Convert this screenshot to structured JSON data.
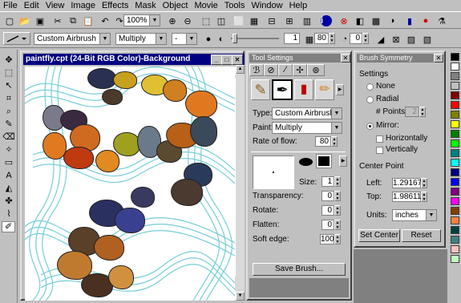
{
  "menu": [
    "File",
    "Edit",
    "View",
    "Image",
    "Effects",
    "Mask",
    "Object",
    "Movie",
    "Tools",
    "Window",
    "Help"
  ],
  "toolbar1": {
    "zoom": "100%"
  },
  "toolbar2": {
    "brush_type": "Custom Airbrush",
    "merge_mode": "Multiply",
    "dash_value": "-",
    "size_value": "1",
    "transparency_value": "80",
    "angle_value": "0"
  },
  "document": {
    "title": "paintfly.cpt  (24-Bit RGB Color)-Background"
  },
  "tool_settings": {
    "title": "Tool Settings",
    "type_label": "Type:",
    "type_value": "Custom Airbrush",
    "paint_label": "Paint:",
    "paint_value": "Multiply",
    "rate_label": "Rate of flow:",
    "rate_value": "80",
    "size_label": "Size:",
    "size_value": "1",
    "transparency_label": "Transparency:",
    "transparency_value": "0",
    "rotate_label": "Rotate:",
    "rotate_value": "0",
    "flatten_label": "Flatten:",
    "flatten_value": "0",
    "soft_edge_label": "Soft edge:",
    "soft_edge_value": "100",
    "save_brush": "Save Brush..."
  },
  "brush_symmetry": {
    "title": "Brush Symmetry",
    "settings_label": "Settings",
    "none_label": "None",
    "radial_label": "Radial",
    "points_label": "# Points:",
    "points_value": "2",
    "mirror_label": "Mirror:",
    "horizontally_label": "Horizontally",
    "vertically_label": "Vertically",
    "center_point_label": "Center Point",
    "left_label": "Left:",
    "left_value": "1.29167",
    "top_label": "Top:",
    "top_value": "1.98611",
    "units_label": "Units:",
    "units_value": "inches",
    "set_center": "Set Center",
    "reset": "Reset",
    "selected_mode": "Mirror"
  },
  "palette_colors": [
    "#000000",
    "#ffffff",
    "#808080",
    "#c0c0c0",
    "#800000",
    "#ff0000",
    "#808000",
    "#ffff00",
    "#008000",
    "#00ff00",
    "#008080",
    "#00ffff",
    "#000080",
    "#0000ff",
    "#800080",
    "#ff00ff",
    "#804000",
    "#ff8040",
    "#004040",
    "#408080",
    "#ffc0c0",
    "#c0ffc0"
  ]
}
